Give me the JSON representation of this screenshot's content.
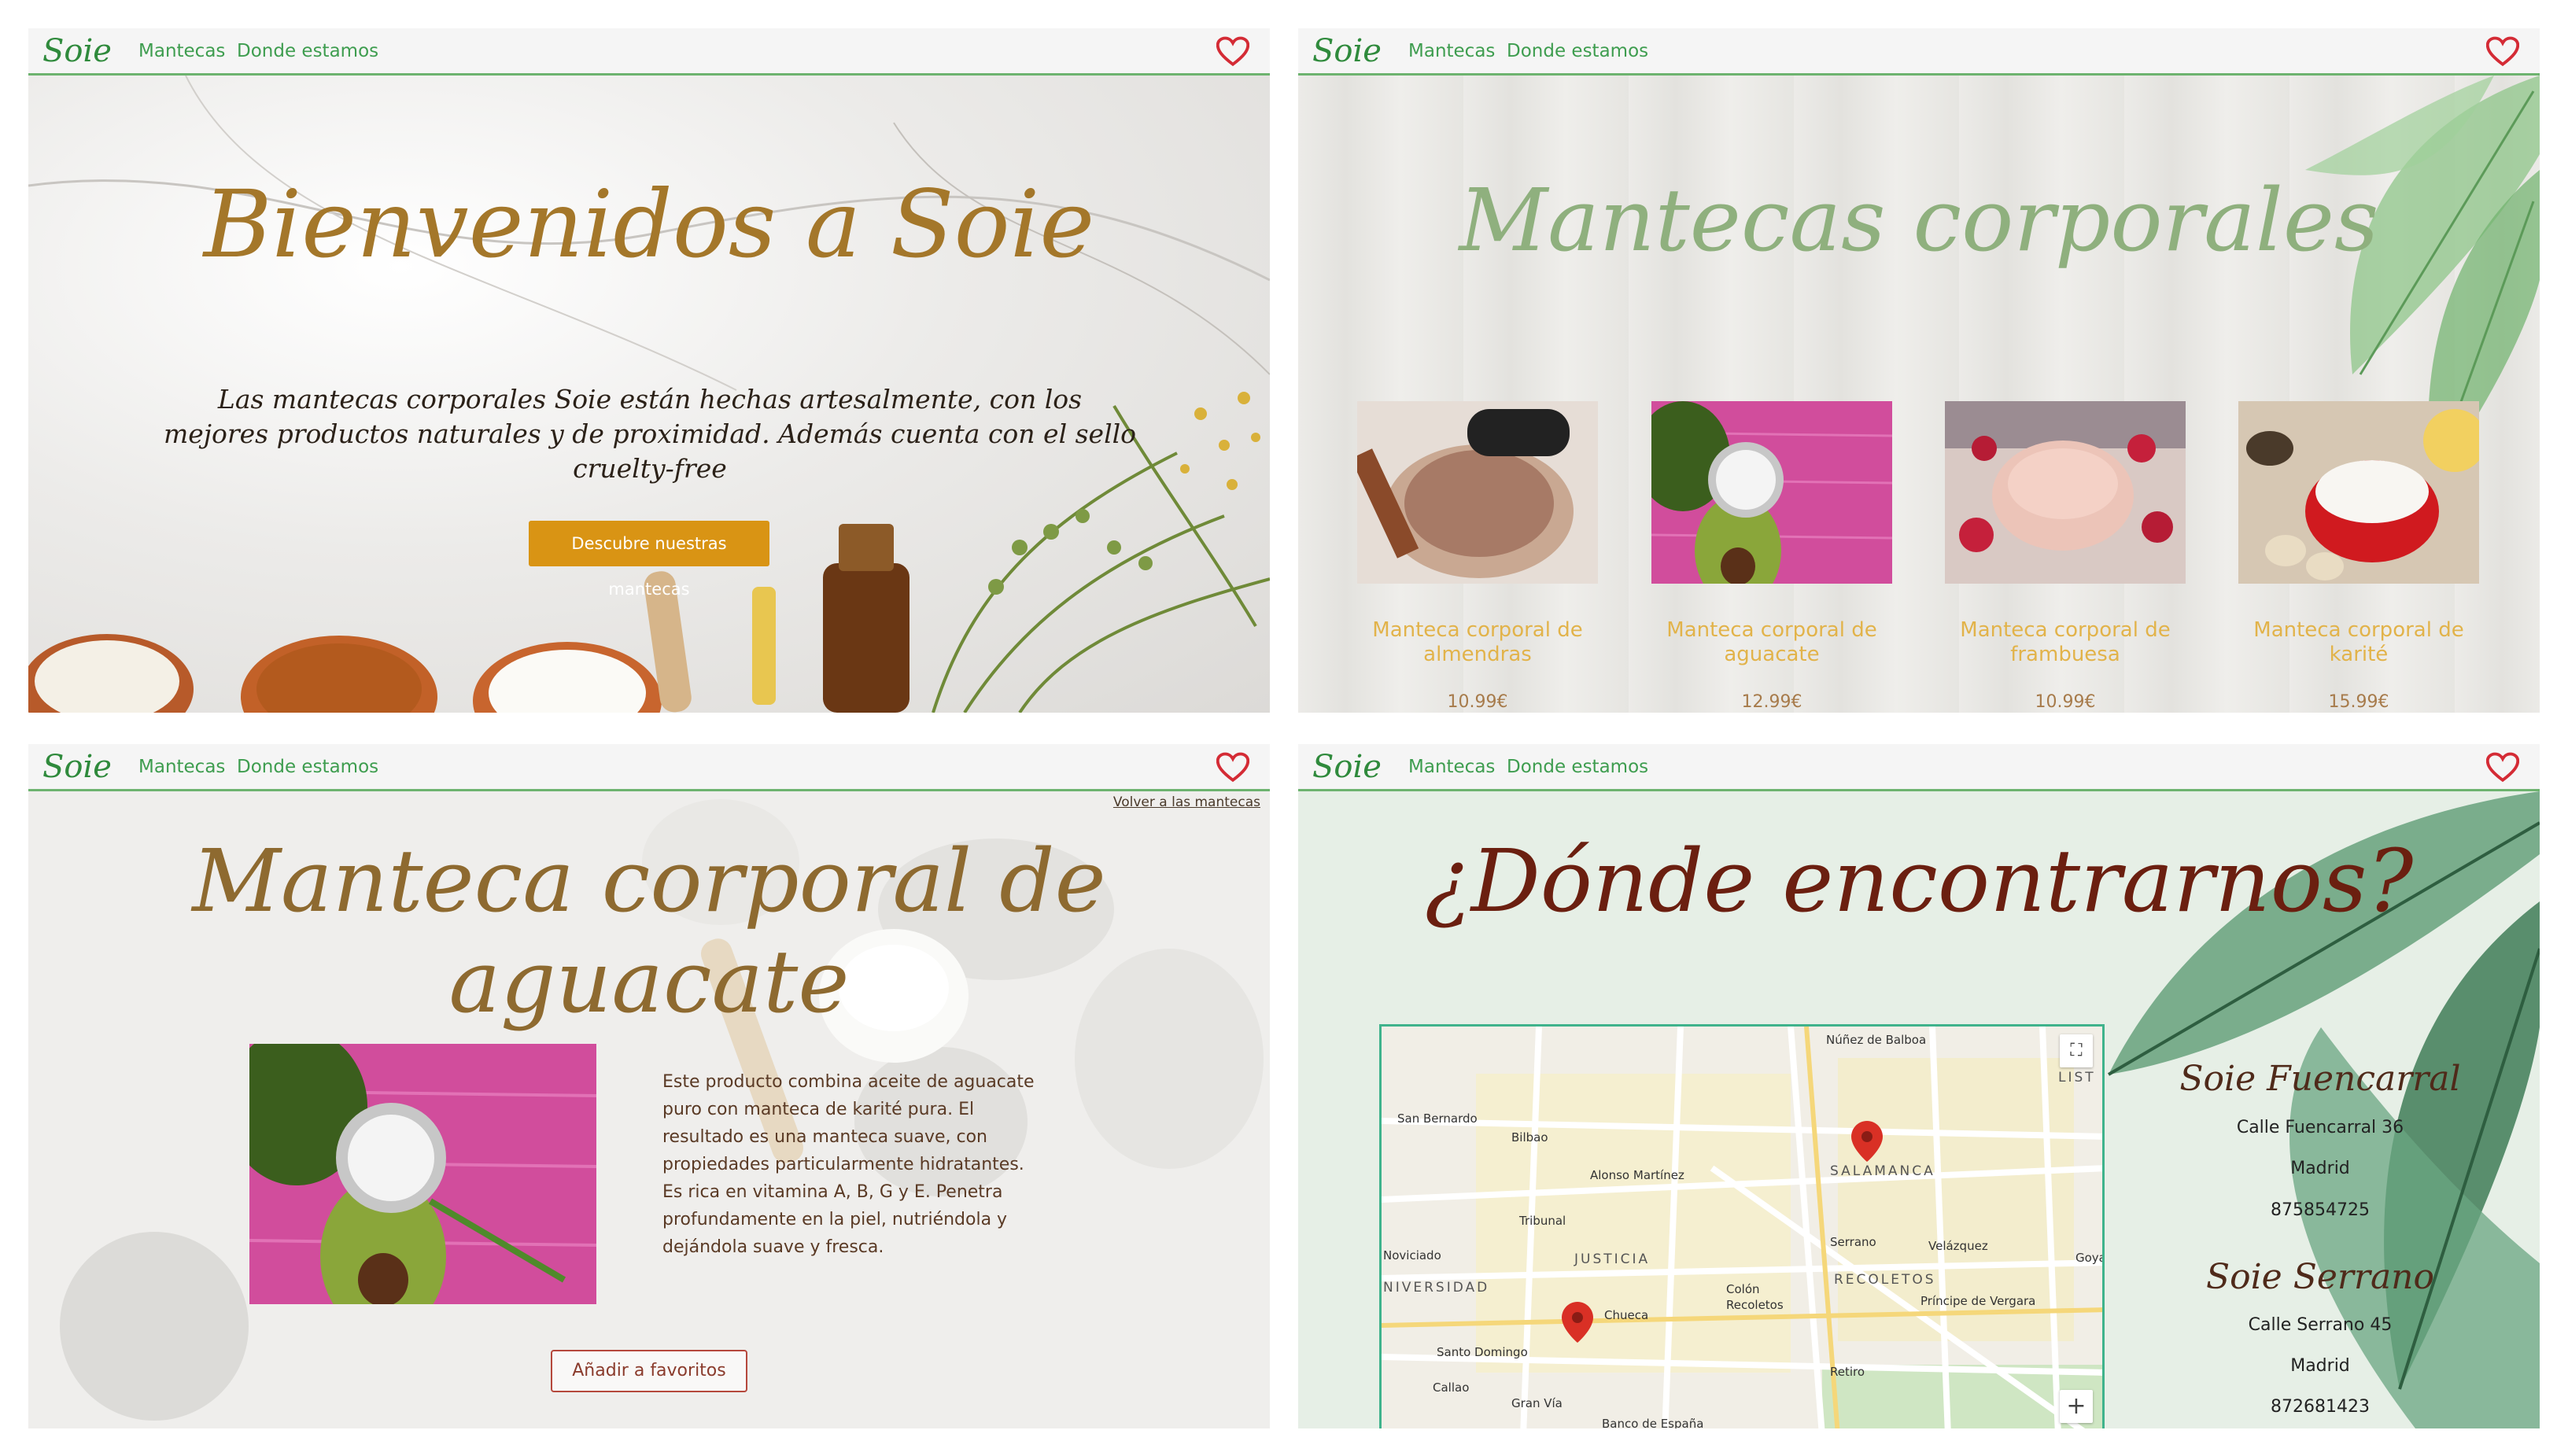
{
  "nav": {
    "brand": "Soie",
    "links": [
      "Mantecas",
      "Donde estamos"
    ]
  },
  "home": {
    "title": "Bienvenidos a Soie",
    "text": "Las mantecas corporales Soie están hechas artesalmente, con los mejores productos naturales y de proximidad. Además cuenta con el sello cruelty-free",
    "button": "Descubre nuestras mantecas"
  },
  "products": {
    "title": "Mantecas corporales",
    "items": [
      {
        "name": "Manteca corporal de almendras",
        "price": "10.99€"
      },
      {
        "name": "Manteca corporal de aguacate",
        "price": "12.99€"
      },
      {
        "name": "Manteca corporal de frambuesa",
        "price": "10.99€"
      },
      {
        "name": "Manteca corporal de karité",
        "price": "15.99€"
      }
    ]
  },
  "detail": {
    "back": "Volver a las mantecas",
    "title": "Manteca corporal de aguacate",
    "description": "Este producto combina aceite de aguacate puro con manteca de karité pura. El resultado es una manteca suave, con propiedades particularmente hidratantes. Es rica en vitamina A, B, G y E. Penetra profundamente en la piel, nutriéndola y dejándola suave y fresca.",
    "button": "Añadir a favoritos"
  },
  "location": {
    "title": "¿Dónde encontrarnos?",
    "stores": [
      {
        "name": "Soie Fuencarral",
        "address": "Calle Fuencarral 36",
        "city": "Madrid",
        "phone": "875854725"
      },
      {
        "name": "Soie Serrano",
        "address": "Calle Serrano 45",
        "city": "Madrid",
        "phone": "872681423"
      }
    ],
    "map_labels": {
      "nunez": "Núñez de Balboa",
      "san_bernardo": "San Bernardo",
      "bilbao": "Bilbao",
      "alonso": "Alonso Martínez",
      "salamanca": "SALAMANCA",
      "tribunal": "Tribunal",
      "noviciado": "Noviciado",
      "justicia": "JUSTICIA",
      "serrano": "Serrano",
      "velazquez": "Velázquez",
      "recoletos_area": "RECOLETOS",
      "universidad": "NIVERSIDAD",
      "chueca": "Chueca",
      "colon": "Colón",
      "recoletos": "Recoletos",
      "principe": "Príncipe de Vergara",
      "santo_domingo": "Santo Domingo",
      "callao": "Callao",
      "gran_via": "Gran Vía",
      "banco": "Banco de España",
      "retiro": "Retiro",
      "lista": "LIST",
      "goya": "Goya"
    }
  },
  "colors": {
    "nav_accent": "#3e9d4f",
    "heart": "#d42b35",
    "hero_title": "#a4772a",
    "button_orange": "#d99414",
    "products_title": "#8fb07e",
    "product_name": "#e2b34a",
    "detail_title": "#8e6a30",
    "location_title": "#6b1f10"
  }
}
